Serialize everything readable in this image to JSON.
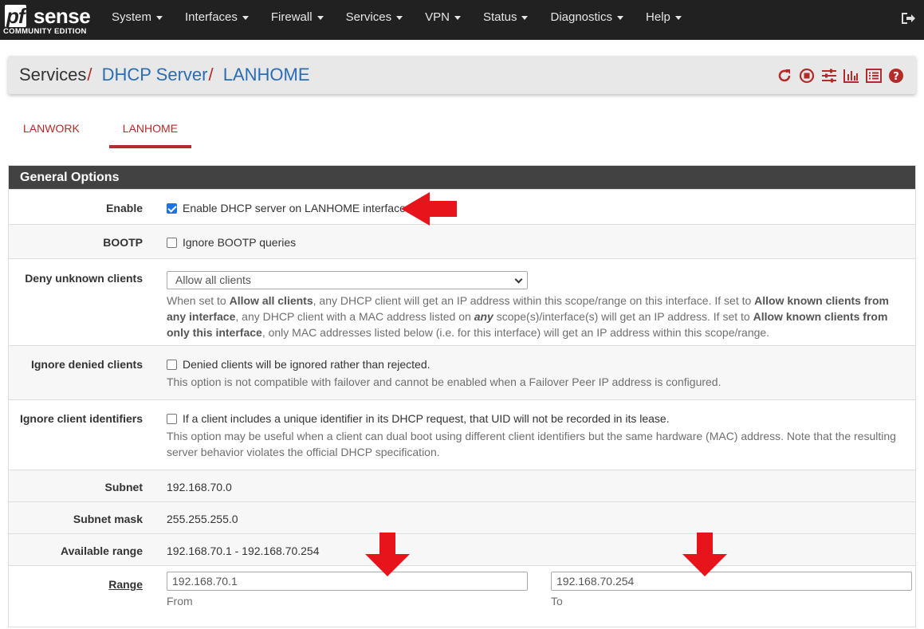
{
  "brand": {
    "logo_pf": "pf",
    "logo_sense": "sense",
    "logo_edition": "COMMUNITY EDITION"
  },
  "nav": {
    "items": [
      "System",
      "Interfaces",
      "Firewall",
      "Services",
      "VPN",
      "Status",
      "Diagnostics",
      "Help"
    ],
    "logout_icon": "sign-out-icon"
  },
  "breadcrumb": {
    "root": "Services",
    "section": "DHCP Server",
    "page": "LANHOME",
    "separator": "/",
    "icons": [
      "restart-icon",
      "stop-icon",
      "sliders-icon",
      "bar-chart-icon",
      "list-icon",
      "help-icon"
    ]
  },
  "tabs": [
    "LANWORK",
    "LANHOME"
  ],
  "active_tab": "LANHOME",
  "panel": {
    "title": "General Options",
    "enable": {
      "label": "Enable",
      "checkbox_text": "Enable DHCP server on LANHOME interface",
      "checked": true
    },
    "bootp": {
      "label": "BOOTP",
      "checkbox_text": "Ignore BOOTP queries",
      "checked": false
    },
    "deny_unknown": {
      "label": "Deny unknown clients",
      "selected": "Allow all clients",
      "help_1": "When set to ",
      "help_b1": "Allow all clients",
      "help_2": ", any DHCP client will get an IP address within this scope/range on this interface. If set to ",
      "help_b2": "Allow known clients from any interface",
      "help_3": ", any DHCP client with a MAC address listed on ",
      "help_b3": "any",
      "help_4": " scope(s)/interface(s) will get an IP address. If set to ",
      "help_b4": "Allow known clients from only this interface",
      "help_5": ", only MAC addresses listed below (i.e. for this interface) will get an IP address within this scope/range."
    },
    "ignore_denied": {
      "label": "Ignore denied clients",
      "checkbox_text": "Denied clients will be ignored rather than rejected.",
      "checked": false,
      "help": "This option is not compatible with failover and cannot be enabled when a Failover Peer IP address is configured."
    },
    "ignore_client_ids": {
      "label": "Ignore client identifiers",
      "checkbox_text": "If a client includes a unique identifier in its DHCP request, that UID will not be recorded in its lease.",
      "checked": false,
      "help": "This option may be useful when a client can dual boot using different client identifiers but the same hardware (MAC) address. Note that the resulting server behavior violates the official DHCP specification."
    },
    "subnet": {
      "label": "Subnet",
      "value": "192.168.70.0"
    },
    "subnet_mask": {
      "label": "Subnet mask",
      "value": "255.255.255.0"
    },
    "available_range": {
      "label": "Available range",
      "value": "192.168.70.1 - 192.168.70.254"
    },
    "range": {
      "label": "Range",
      "from_value": "192.168.70.1",
      "from_label": "From",
      "to_value": "192.168.70.254",
      "to_label": "To"
    }
  },
  "colors": {
    "navbar": "#212121",
    "accent_red": "#b32b2b",
    "link_blue": "#2a6db4",
    "annotation_arrow": "#e8141b",
    "panel_heading": "#424242"
  }
}
